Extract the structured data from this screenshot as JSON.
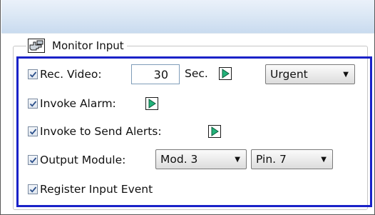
{
  "group": {
    "title": "Monitor Input",
    "icon": "hand-pointer-icon"
  },
  "rows": {
    "rec_video": {
      "checked": true,
      "label": "Rec. Video:",
      "seconds_value": "30",
      "unit": "Sec.",
      "priority": "Urgent"
    },
    "invoke_alarm": {
      "checked": true,
      "label": "Invoke Alarm:"
    },
    "invoke_alerts": {
      "checked": true,
      "label": "Invoke to Send Alerts:"
    },
    "output_module": {
      "checked": true,
      "label": "Output Module:",
      "module": "Mod. 3",
      "pin": "Pin. 7"
    },
    "register_event": {
      "checked": true,
      "label": "Register Input Event"
    }
  },
  "colors": {
    "highlight_border": "#1a22c8",
    "play_arrow": "#22b27a"
  }
}
